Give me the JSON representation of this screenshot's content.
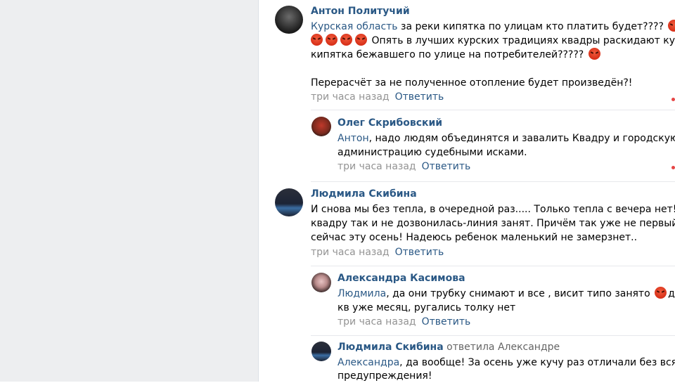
{
  "comments": [
    {
      "author": "Антон Политучий",
      "mention": "Курская область",
      "line1": " за реки кипятка по улицам кто платить будет???? ",
      "line2": " Опять в лучших курских традициях квадры раскидают кубы",
      "line3": "кипятка бежавшего по улице на потребителей????? ",
      "line4": "Перерасчёт за не полученное отопление будет произведён?!",
      "time": "три часа назад",
      "reply": "Ответить"
    },
    {
      "author": "Олег Скрибовский",
      "mention": "Антон",
      "line1": ", надо людям объединятся и завалить Квадру и городскую",
      "line2": "администрацию судебными исками.",
      "time": "три часа назад",
      "reply": "Ответить"
    },
    {
      "author": "Людмила Скибина",
      "line1": "И снова мы без тепла, в очередной раз..... Только тепла с вечера нет! В",
      "line2": "квадру так и не дозвонилась-линия занят. Причём так уже не первый раз",
      "line3": "сейчас эту осень! Надеюсь ребенок маленький не замерзнет..",
      "time": "три часа назад",
      "reply": "Ответить"
    },
    {
      "author": "Александра Касимова",
      "mention": "Людмила",
      "line1": ", да они трубку снимают и все , висит типо занято ",
      "line1_tail": "дубак",
      "line2": "кв уже месяц, ругались толку нет",
      "time": "три часа назад",
      "reply": "Ответить"
    },
    {
      "author": "Людмила Скибина",
      "author_extra": " ответила Александре",
      "mention": "Александра",
      "line1": ", да вообще! За осень уже кучу раз отличали без всякого",
      "line2": "предупреждения!"
    }
  ],
  "icons": {
    "angry_emoji": "angry-face-emoji"
  },
  "colors": {
    "link": "#2a5885",
    "meta": "#939393",
    "emoji": "#d42a14"
  }
}
